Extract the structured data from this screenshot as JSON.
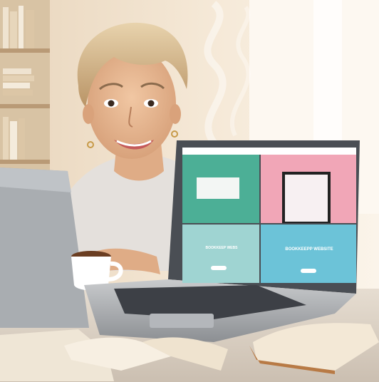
{
  "scene": {
    "left_panel_label": "BOOKKEEP WEBS",
    "right_panel_label": "BOOKKEEPP WEBSITE"
  },
  "colors": {
    "wall": "#f3e6d4",
    "teal": "#4caf96",
    "pink": "#f1a6b7",
    "light_teal": "#9fd4d2",
    "sky": "#6cc3d8"
  }
}
